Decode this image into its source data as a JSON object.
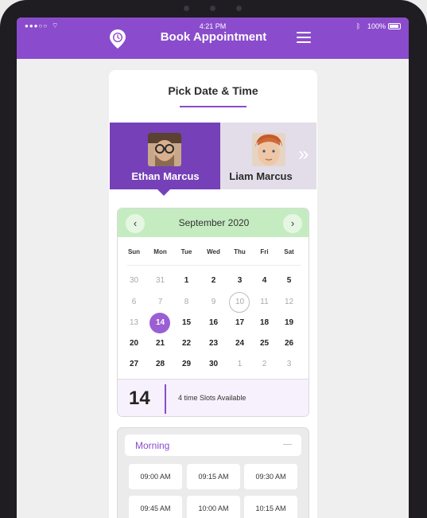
{
  "status": {
    "time": "4:21 PM",
    "battery": "100%"
  },
  "header": {
    "title": "Book Appointment"
  },
  "card": {
    "title": "Pick Date & Time"
  },
  "doctors": [
    {
      "name": "Ethan Marcus",
      "active": true
    },
    {
      "name": "Liam Marcus",
      "active": false
    }
  ],
  "calendar": {
    "month": "September 2020",
    "weekdays": [
      "Sun",
      "Mon",
      "Tue",
      "Wed",
      "Thu",
      "Fri",
      "Sat"
    ],
    "weeks": [
      [
        "30",
        "31",
        "1",
        "2",
        "3",
        "4",
        "5"
      ],
      [
        "6",
        "7",
        "8",
        "9",
        "10",
        "11",
        "12"
      ],
      [
        "13",
        "14",
        "15",
        "16",
        "17",
        "18",
        "19"
      ],
      [
        "20",
        "21",
        "22",
        "23",
        "24",
        "25",
        "26"
      ],
      [
        "27",
        "28",
        "29",
        "30",
        "1",
        "2",
        "3"
      ]
    ],
    "selected_day": "14",
    "slots_summary": "4 time Slots Available"
  },
  "time_slots": {
    "section": "Morning",
    "slots": [
      "09:00 AM",
      "09:15 AM",
      "09:30 AM",
      "09:45 AM",
      "10:00 AM",
      "10:15 AM"
    ]
  }
}
